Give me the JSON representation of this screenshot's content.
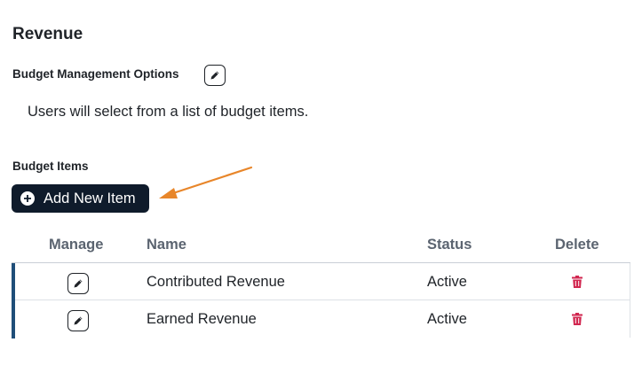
{
  "section": {
    "title": "Revenue",
    "options_label": "Budget Management Options",
    "description": "Users will select from a list of budget items.",
    "items_label": "Budget Items",
    "add_button_label": "Add New Item"
  },
  "table": {
    "headers": {
      "manage": "Manage",
      "name": "Name",
      "status": "Status",
      "delete": "Delete"
    },
    "rows": [
      {
        "name": "Contributed Revenue",
        "status": "Active"
      },
      {
        "name": "Earned Revenue",
        "status": "Active"
      }
    ]
  },
  "icons": {
    "edit": "pencil-icon",
    "add": "plus-circle-icon",
    "delete": "trash-icon",
    "annotation": "arrow-annotation"
  },
  "colors": {
    "primary_button": "#0f1b2b",
    "delete": "#d1264f",
    "arrow": "#e8862a",
    "row_accent": "#1f4e79",
    "header_text": "#5b6470"
  }
}
